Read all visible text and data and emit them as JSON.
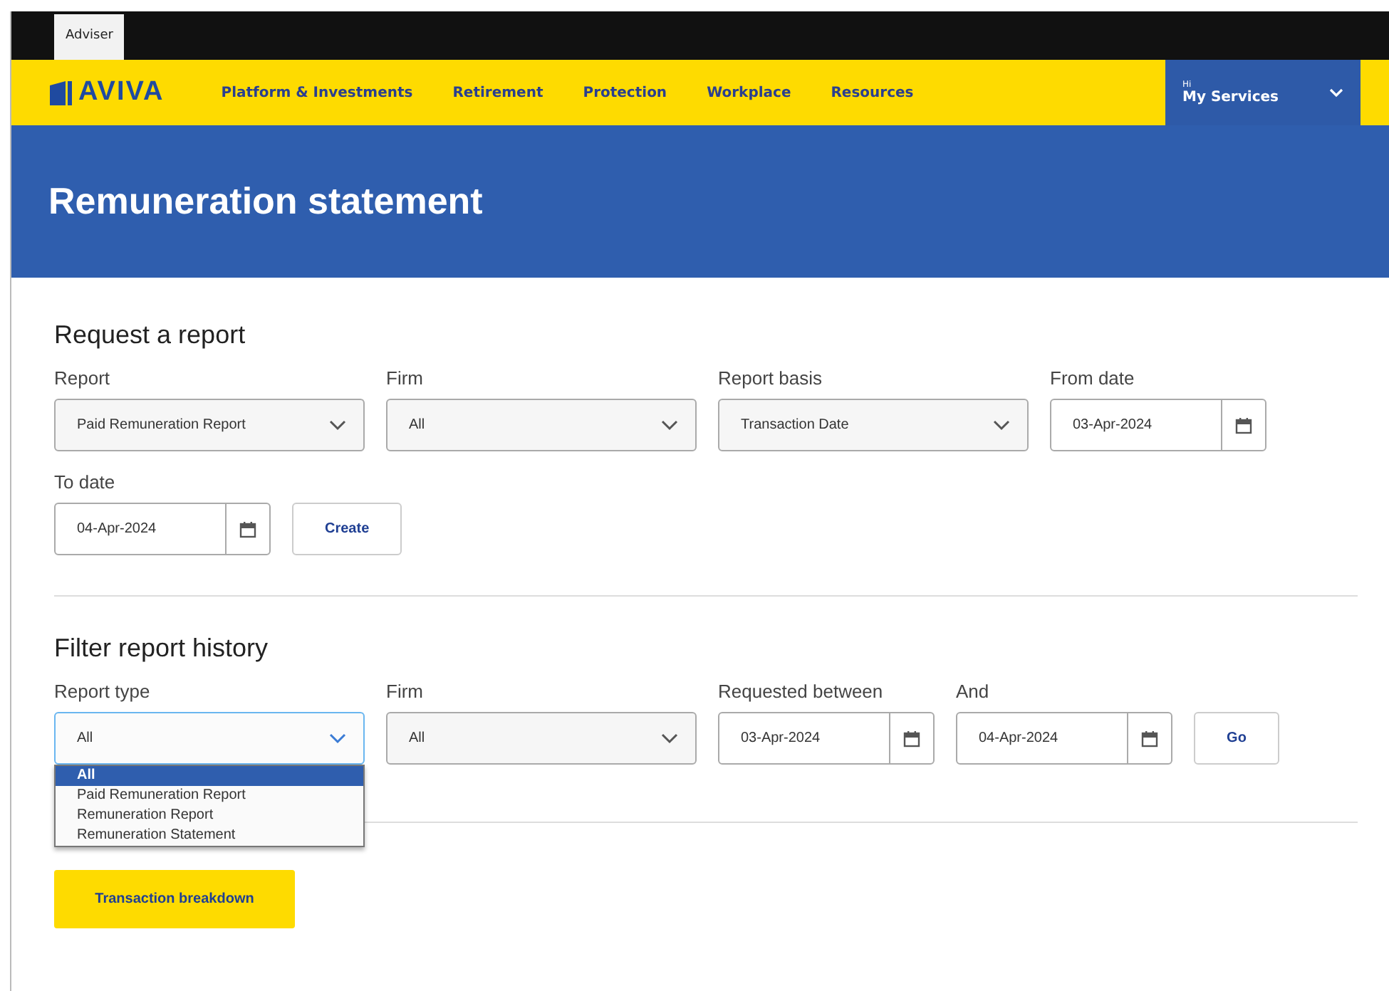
{
  "top_bar": {
    "tabs": [
      {
        "label": "Adviser",
        "selected": true
      }
    ]
  },
  "nav": {
    "logo": "AVIVA",
    "links": [
      "Platform & Investments",
      "Retirement",
      "Protection",
      "Workplace",
      "Resources"
    ],
    "account": {
      "greeting": "Hi",
      "label": "My Services"
    }
  },
  "banner": {
    "title": "Remuneration statement"
  },
  "request": {
    "heading": "Request a report",
    "fields": [
      {
        "kind": "select",
        "label": "Report",
        "value": "Paid Remuneration Report",
        "focused": false
      },
      {
        "kind": "select",
        "label": "Firm",
        "value": "All",
        "focused": false
      },
      {
        "kind": "select",
        "label": "Report basis",
        "value": "Transaction Date",
        "focused": false
      },
      {
        "kind": "date",
        "label": "From date",
        "value": "03-Apr-2024",
        "focused": false
      },
      {
        "kind": "date",
        "label": "To date",
        "value": "04-Apr-2024",
        "focused": false
      }
    ],
    "button": "Create"
  },
  "filter": {
    "heading": "Filter report history",
    "fields": [
      {
        "kind": "select",
        "label": "Report type",
        "value": "All",
        "focused": true,
        "options": [
          {
            "label": "All",
            "selected": true
          },
          {
            "label": "Paid Remuneration Report",
            "selected": false
          },
          {
            "label": "Remuneration Report",
            "selected": false
          },
          {
            "label": "Remuneration Statement",
            "selected": false
          }
        ]
      },
      {
        "kind": "select",
        "label": "Firm",
        "value": "All",
        "focused": false
      },
      {
        "kind": "date",
        "label": "Requested between",
        "value": "03-Apr-2024",
        "focused": false
      },
      {
        "kind": "date",
        "label": "And",
        "value": "04-Apr-2024",
        "focused": false
      }
    ],
    "button": "Go"
  },
  "actions": [
    "Transaction breakdown"
  ]
}
